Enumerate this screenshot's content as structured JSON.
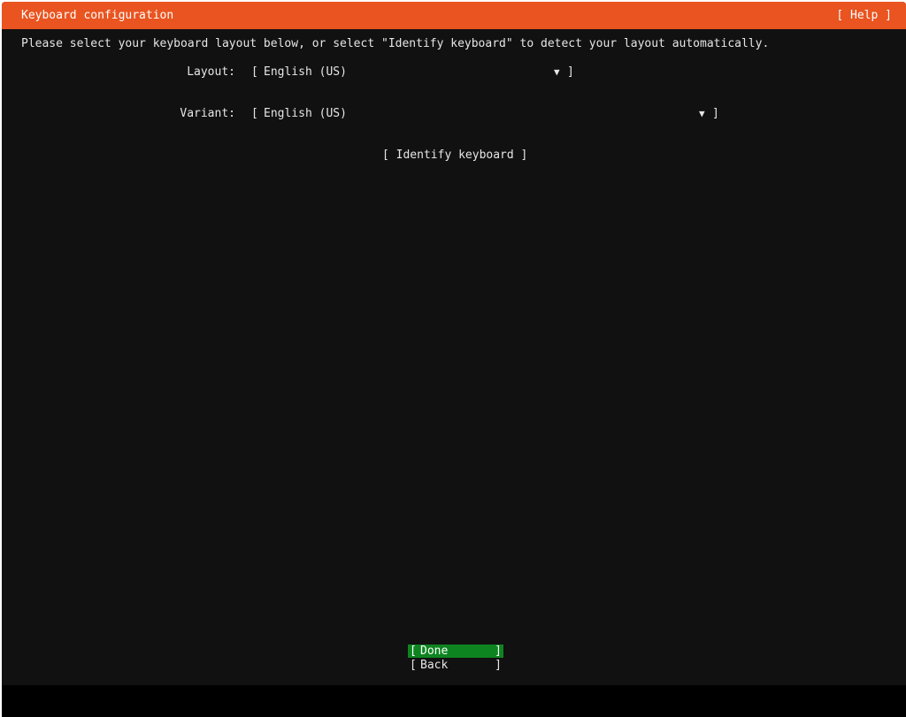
{
  "header": {
    "title": "Keyboard configuration",
    "help_label": "[ Help ]"
  },
  "instruction": "Please select your keyboard layout below, or select \"Identify keyboard\" to detect your layout automatically.",
  "layout_field": {
    "label": "Layout:",
    "open_bracket": "[",
    "value": "English (US)",
    "arrow": "▼",
    "close_bracket": "]"
  },
  "variant_field": {
    "label": "Variant:",
    "open_bracket": "[",
    "value": "English (US)",
    "arrow": "▼",
    "close_bracket": "]"
  },
  "identify_button": {
    "label": "[ Identify keyboard ]"
  },
  "actions": {
    "done": {
      "open": "[",
      "label": "Done",
      "close": "]"
    },
    "back": {
      "open": "[",
      "label": "Back",
      "close": "]"
    }
  },
  "colors": {
    "header_bg": "#e95420",
    "screen_bg": "#111111",
    "done_bg": "#0e8420",
    "text": "#e6e6e6"
  }
}
